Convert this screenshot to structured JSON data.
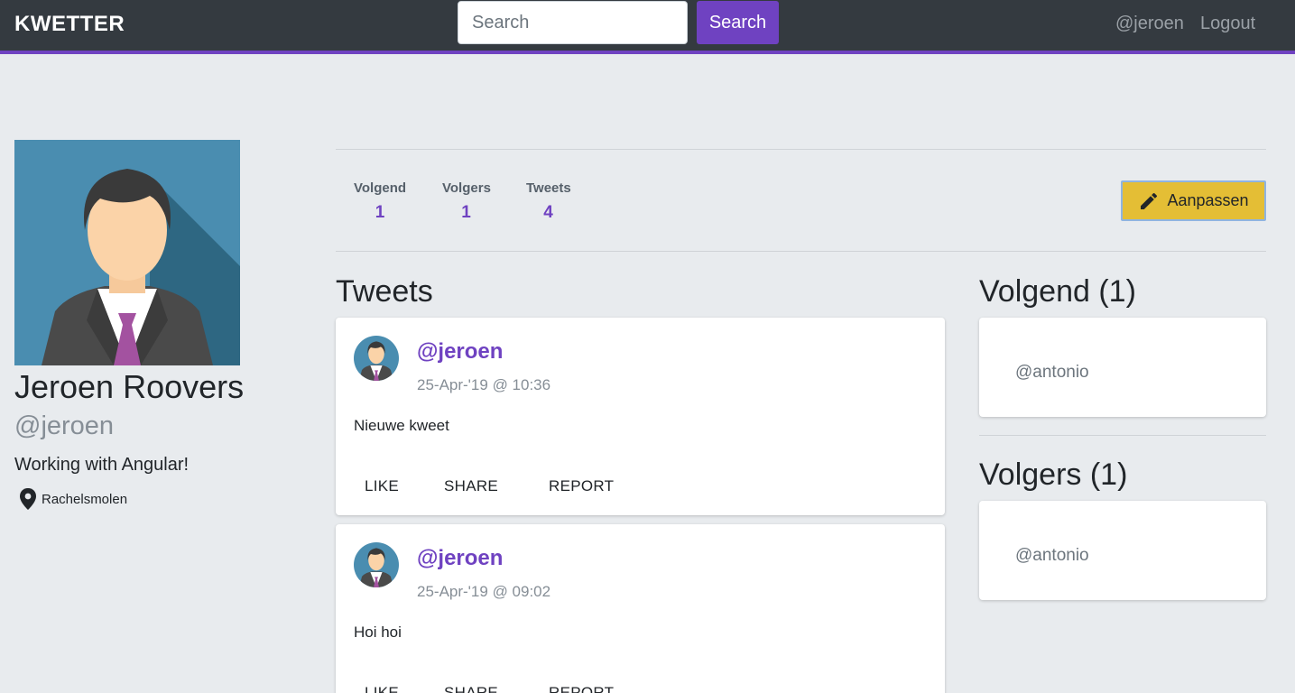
{
  "navbar": {
    "brand": "KWETTER",
    "search_placeholder": "Search",
    "search_button": "Search",
    "user_link": "@jeroen",
    "logout_link": "Logout"
  },
  "profile": {
    "name": "Jeroen Roovers",
    "handle": "@jeroen",
    "bio": "Working with Angular!",
    "location": "Rachelsmolen"
  },
  "stats": [
    {
      "label": "Volgend",
      "value": "1"
    },
    {
      "label": "Volgers",
      "value": "1"
    },
    {
      "label": "Tweets",
      "value": "4"
    }
  ],
  "edit_button": "Aanpassen",
  "tweets_title": "Tweets",
  "tweets": [
    {
      "user": "@jeroen",
      "date": "25-Apr-'19 @ 10:36",
      "text": "Nieuwe kweet",
      "actions": [
        "LIKE",
        "SHARE",
        "REPORT"
      ]
    },
    {
      "user": "@jeroen",
      "date": "25-Apr-'19 @ 09:02",
      "text": "Hoi hoi",
      "actions": [
        "LIKE",
        "SHARE",
        "REPORT"
      ]
    }
  ],
  "following": {
    "title": "Volgend (1)",
    "users": [
      "@antonio"
    ]
  },
  "followers": {
    "title": "Volgers (1)",
    "users": [
      "@antonio"
    ]
  },
  "colors": {
    "accent": "#6f42c1",
    "navbar": "#343a40",
    "edit": "#e4be35",
    "background": "#e8ebee"
  }
}
